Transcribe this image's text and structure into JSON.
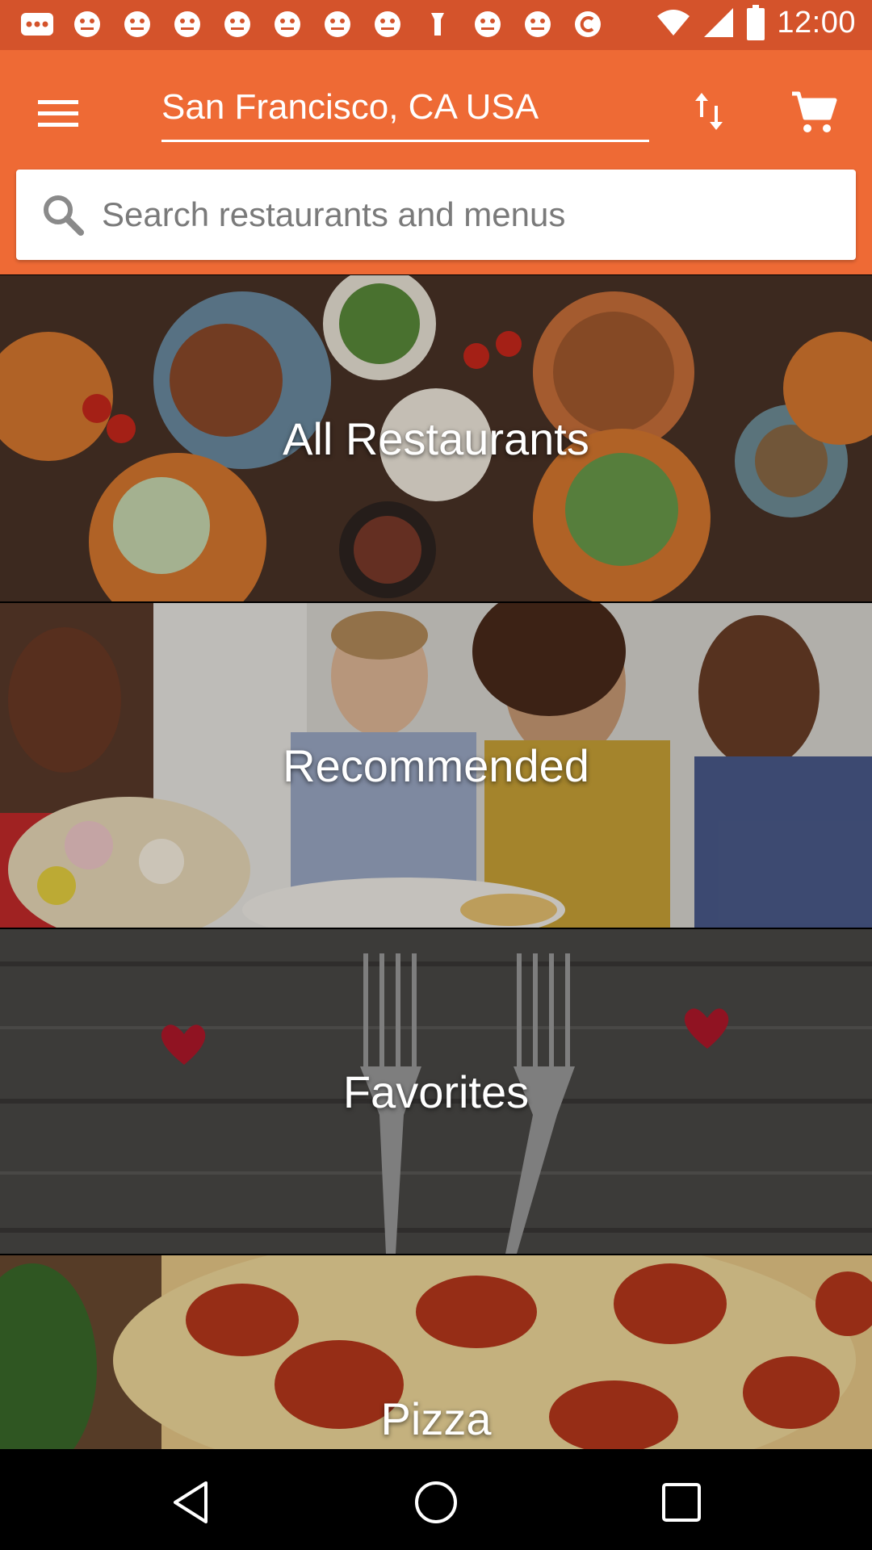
{
  "status_bar": {
    "time": "12:00",
    "icons": [
      "more-icon",
      "notification-icon",
      "notification-icon",
      "notification-icon",
      "notification-icon",
      "notification-icon",
      "notification-icon",
      "notification-icon",
      "notification-icon",
      "notification-icon",
      "upload-icon",
      "notification-icon",
      "notification-icon",
      "copyright-icon",
      "wifi-icon",
      "signal-icon",
      "battery-icon"
    ]
  },
  "app_bar": {
    "location": "San Francisco, CA USA",
    "accent_color": "#ee6a35",
    "status_color": "#d4532b"
  },
  "search": {
    "placeholder": "Search restaurants and menus",
    "value": ""
  },
  "categories": [
    {
      "label": "All Restaurants"
    },
    {
      "label": "Recommended"
    },
    {
      "label": "Favorites"
    },
    {
      "label": "Pizza"
    }
  ],
  "nav": {
    "icons": [
      "back-icon",
      "home-icon",
      "recents-icon"
    ]
  }
}
